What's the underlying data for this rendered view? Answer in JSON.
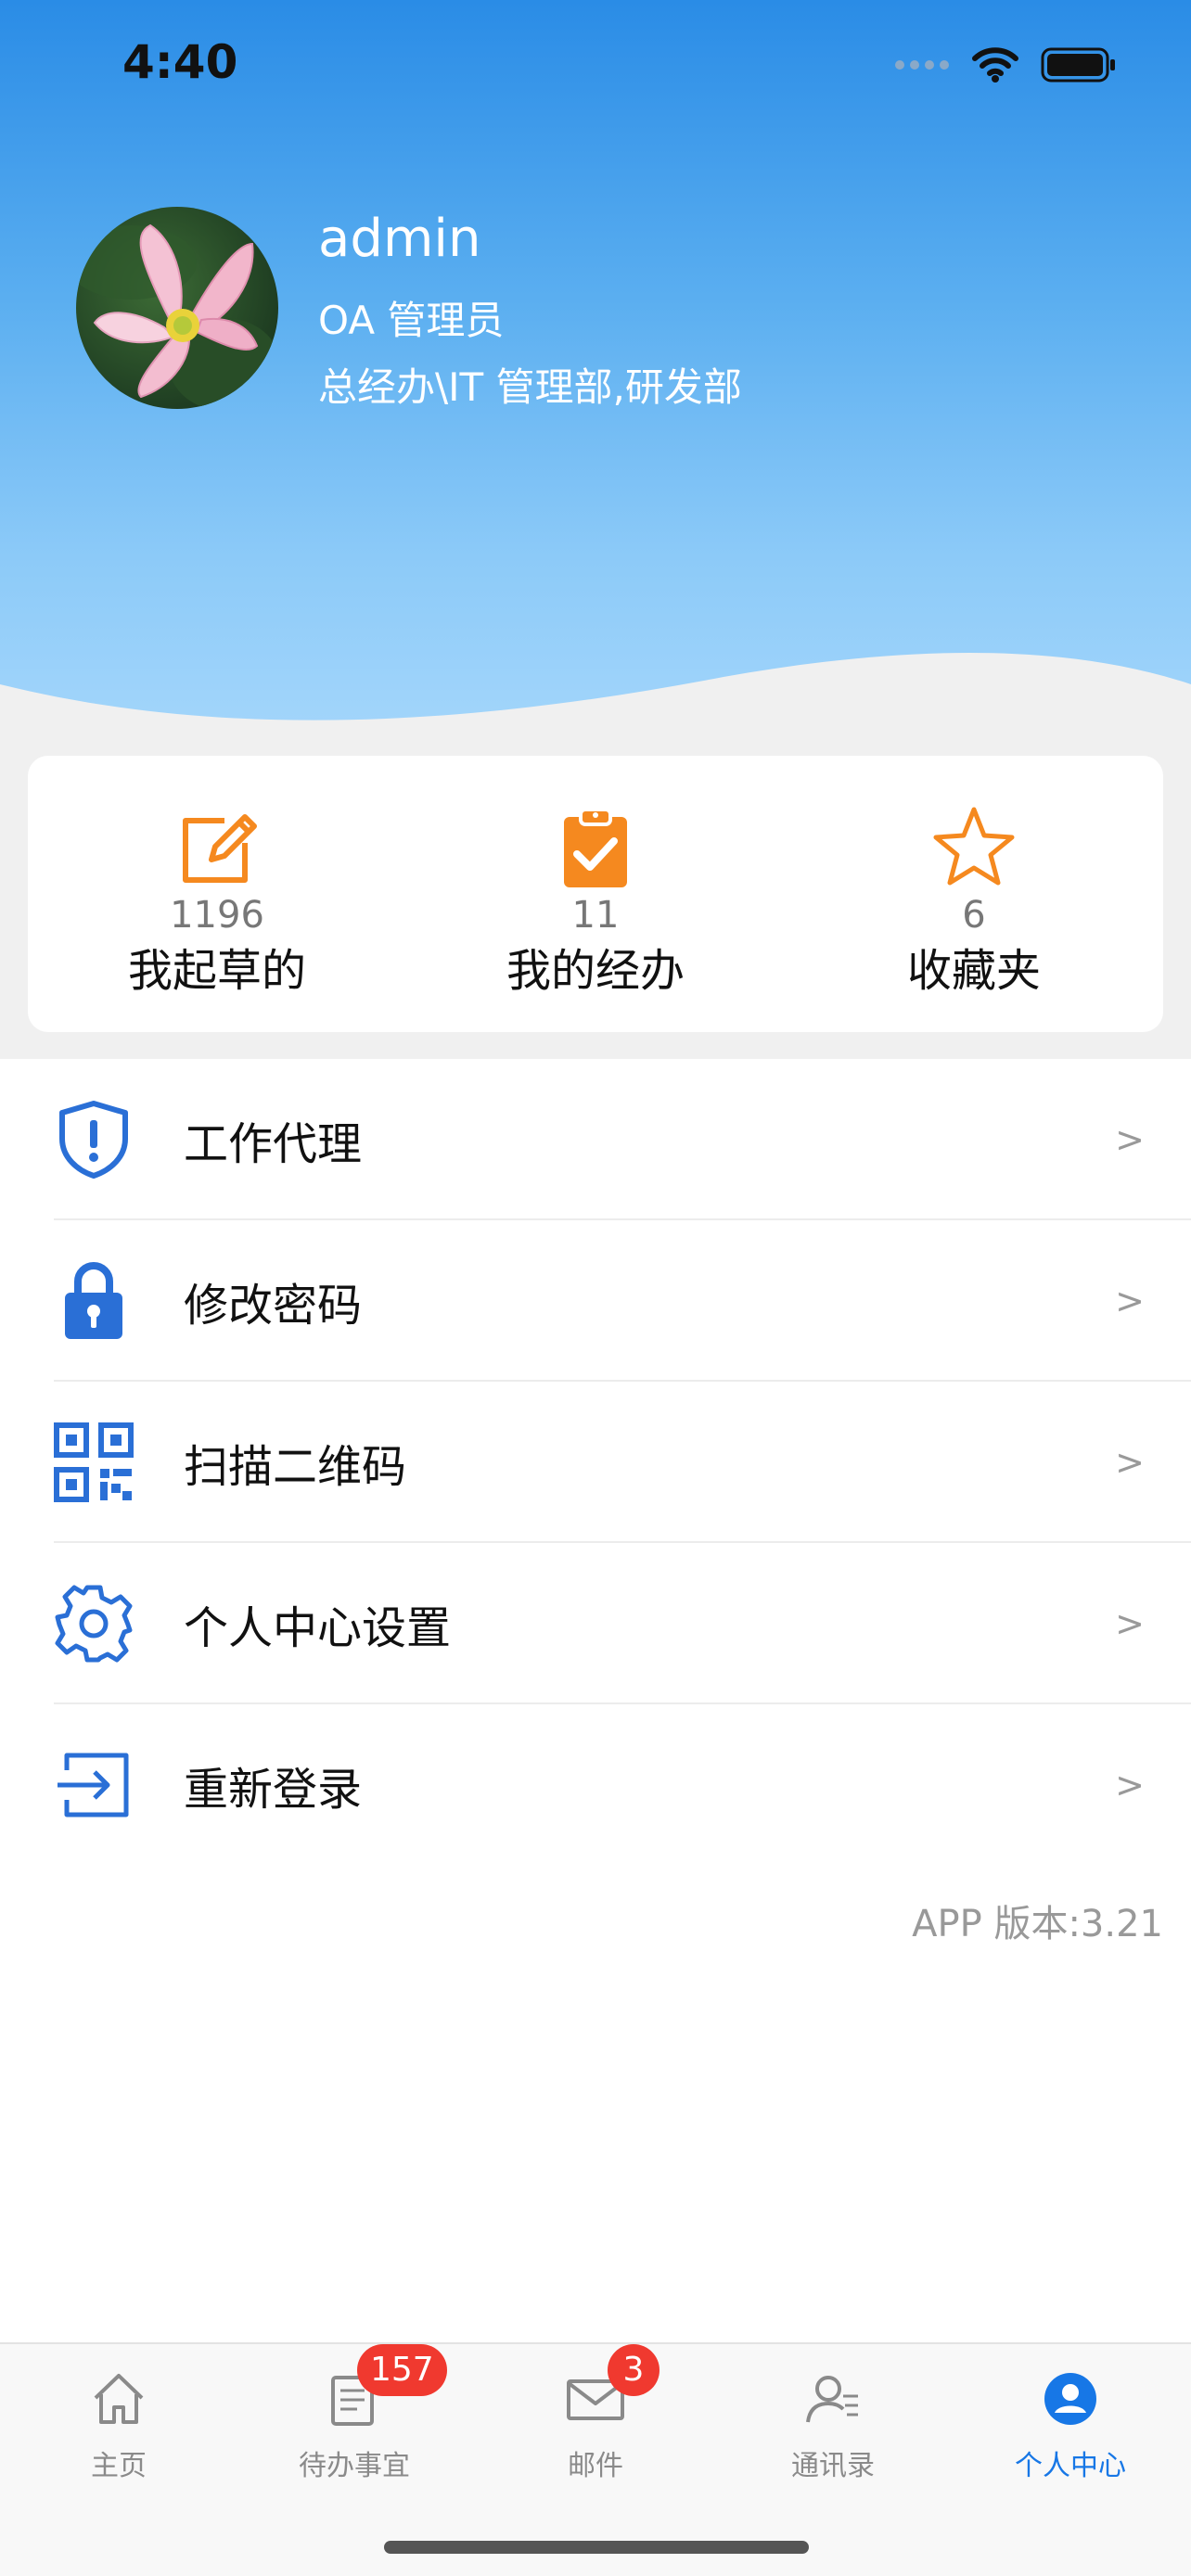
{
  "status_bar": {
    "time": "4:40"
  },
  "profile": {
    "name": "admin",
    "role": "OA 管理员",
    "department": "总经办\\IT 管理部,研发部"
  },
  "stats": [
    {
      "icon": "edit-icon",
      "count": "1196",
      "label": "我起草的"
    },
    {
      "icon": "clipboard-check-icon",
      "count": "11",
      "label": "我的经办"
    },
    {
      "icon": "star-icon",
      "count": "6",
      "label": "收藏夹"
    }
  ],
  "menu": [
    {
      "icon": "shield-alert-icon",
      "label": "工作代理",
      "chevron": ">"
    },
    {
      "icon": "lock-icon",
      "label": "修改密码",
      "chevron": ">"
    },
    {
      "icon": "qr-code-icon",
      "label": "扫描二维码",
      "chevron": ">"
    },
    {
      "icon": "gear-icon",
      "label": "个人中心设置",
      "chevron": ">"
    },
    {
      "icon": "logout-icon",
      "label": "重新登录",
      "chevron": ">"
    }
  ],
  "version": "APP 版本:3.21",
  "tabs": [
    {
      "icon": "home-icon",
      "label": "主页",
      "badge": ""
    },
    {
      "icon": "todo-icon",
      "label": "待办事宜",
      "badge": "157"
    },
    {
      "icon": "mail-icon",
      "label": "邮件",
      "badge": "3"
    },
    {
      "icon": "contacts-icon",
      "label": "通讯录",
      "badge": ""
    },
    {
      "icon": "user-icon",
      "label": "个人中心",
      "badge": ""
    }
  ],
  "colors": {
    "accent_blue": "#1777e6",
    "icon_blue": "#2a6fd6",
    "orange": "#f5891f",
    "badge_red": "#f0392f"
  }
}
